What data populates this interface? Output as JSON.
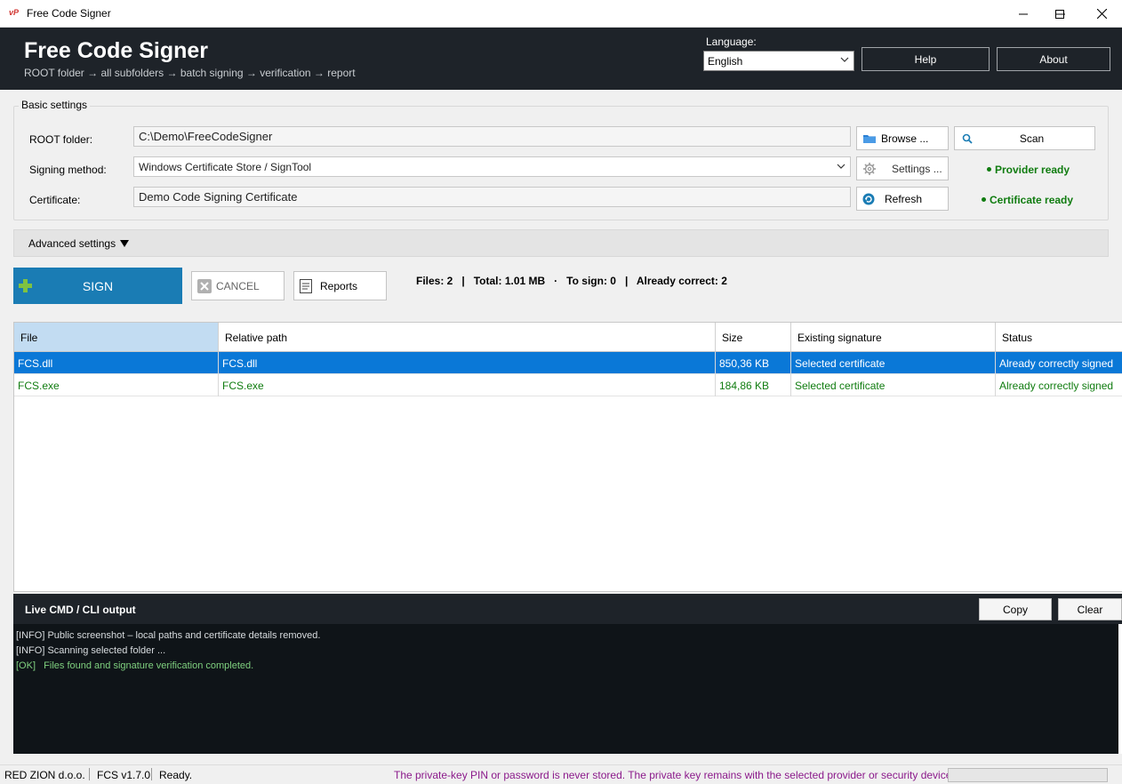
{
  "window": {
    "app_icon_text": "vP",
    "title": "Free Code Signer"
  },
  "header": {
    "title": "Free Code Signer",
    "subtitle": "ROOT folder → all subfolders → batch signing → verification → report",
    "language_label": "Language:",
    "language_value": "English",
    "help_label": "Help",
    "about_label": "About"
  },
  "basic": {
    "legend": "Basic settings",
    "root_label": "ROOT folder:",
    "root_value": "C:\\Demo\\FreeCodeSigner",
    "method_label": "Signing method:",
    "method_value": "Windows Certificate Store / SignTool",
    "cert_label": "Certificate:",
    "cert_value": "Demo Code Signing Certificate",
    "browse_label": "Browse ...",
    "scan_label": "Scan",
    "settings_label": "Settings ...",
    "refresh_label": "Refresh",
    "provider_status": "Provider ready",
    "certificate_status": "Certificate ready",
    "status_color": "#107c10"
  },
  "advanced": {
    "label": "Advanced settings"
  },
  "actions": {
    "sign_label": "SIGN",
    "cancel_label": "CANCEL",
    "reports_label": "Reports",
    "summary": "Files: 2   |   Total: 1.01 MB   ·   To sign: 0   |   Already correct: 2",
    "accent_color": "#1a7cb4"
  },
  "table": {
    "columns": [
      "File",
      "Relative path",
      "Size",
      "Existing signature",
      "Status"
    ],
    "rows": [
      {
        "file": "FCS.dll",
        "path": "FCS.dll",
        "size": "850,36 KB",
        "signature": "Selected certificate",
        "status": "Already correctly signed"
      },
      {
        "file": "FCS.exe",
        "path": "FCS.exe",
        "size": "184,86 KB",
        "signature": "Selected certificate",
        "status": "Already correctly signed"
      }
    ],
    "selection_color": "#0a78d7"
  },
  "log": {
    "title": "Live CMD / CLI output",
    "copy_label": "Copy",
    "clear_label": "Clear",
    "lines": [
      {
        "level": "info",
        "text": "[INFO] Public screenshot – local paths and certificate details removed."
      },
      {
        "level": "info",
        "text": "[INFO] Scanning selected folder ..."
      },
      {
        "level": "ok",
        "text": "[OK]   Files found and signature verification completed."
      }
    ]
  },
  "statusbar": {
    "company": "RED ZION d.o.o.",
    "version": "FCS v1.7.0",
    "state": "Ready.",
    "note": "The private-key PIN or password is never stored. The private key remains with the selected provider or security device.",
    "note_color": "#8b1a8b",
    "progress": 0
  }
}
